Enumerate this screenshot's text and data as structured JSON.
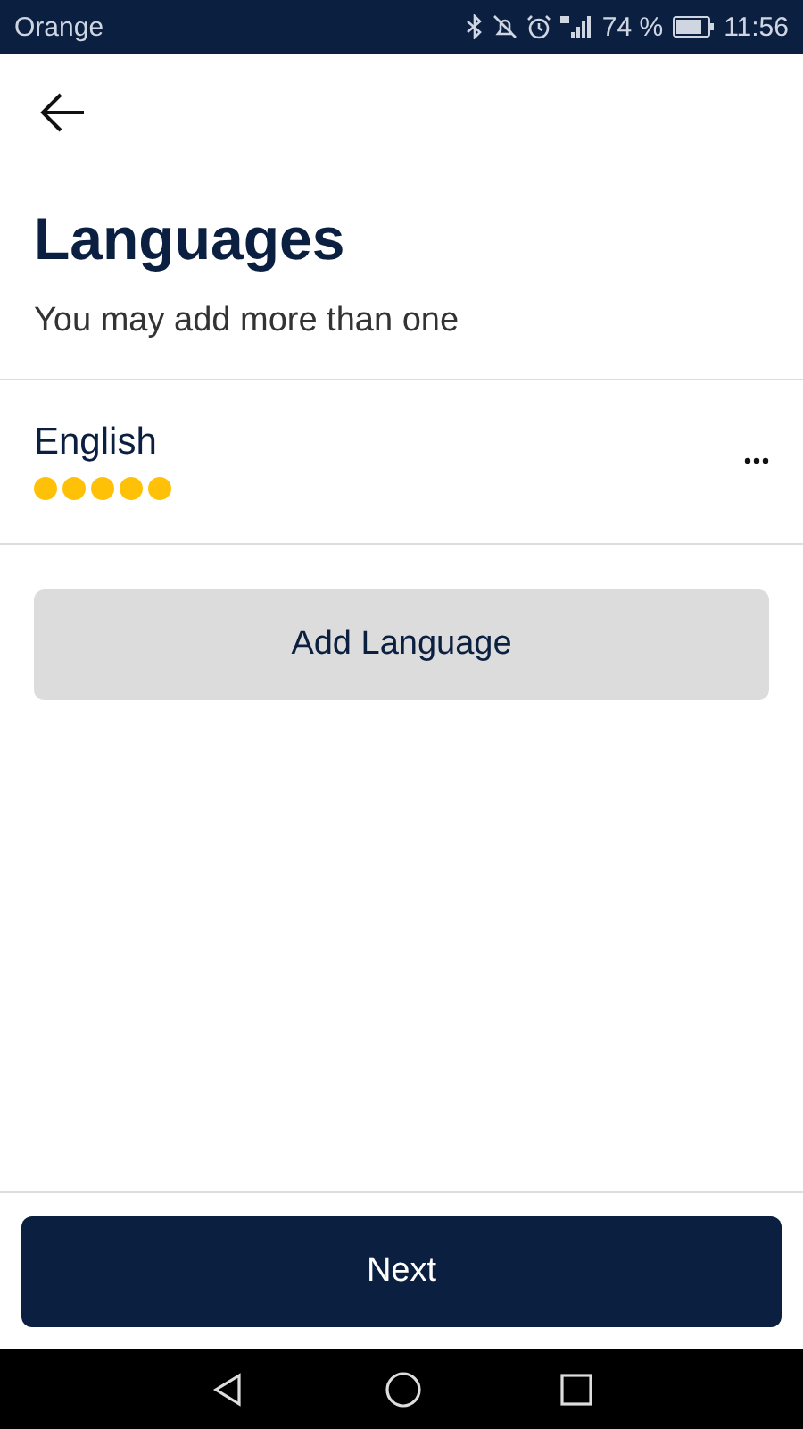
{
  "status_bar": {
    "carrier": "Orange",
    "battery": "74 %",
    "time": "11:56"
  },
  "header": {
    "title": "Languages",
    "subtitle": "You may add more than one"
  },
  "languages": [
    {
      "name": "English",
      "stars": 5
    }
  ],
  "add_button": "Add Language",
  "next_button": "Next"
}
